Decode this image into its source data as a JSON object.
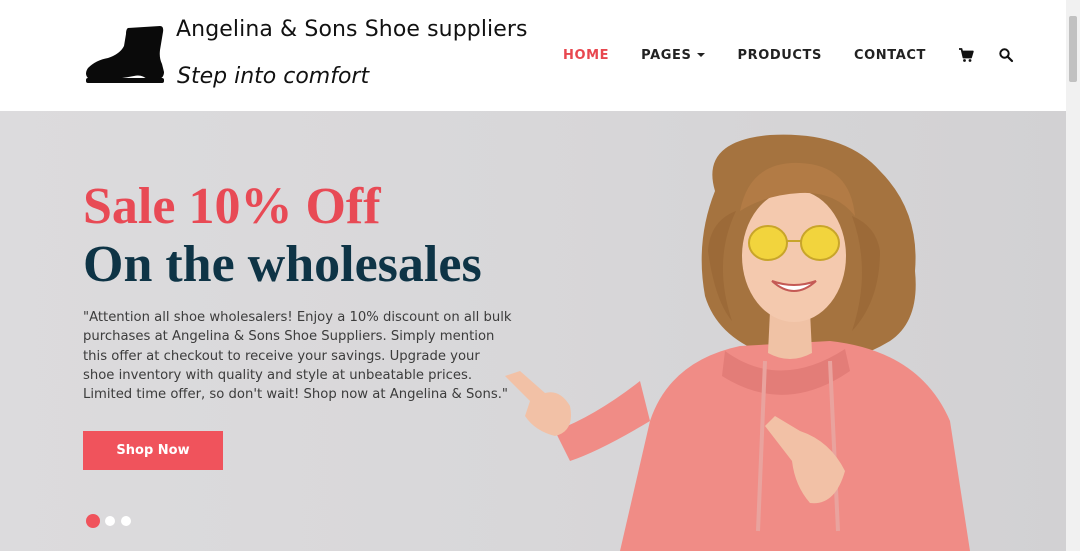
{
  "brand": {
    "name": "Angelina & Sons Shoe suppliers",
    "tagline": "Step into comfort"
  },
  "nav": {
    "items": [
      "HOME",
      "PAGES",
      "PRODUCTS",
      "CONTACT"
    ],
    "active": "HOME",
    "icons": [
      "cart-icon",
      "search-icon"
    ]
  },
  "hero": {
    "headline1": "Sale 10% Off",
    "headline2": "On the wholesales",
    "description": "\"Attention all shoe wholesalers! Enjoy a 10% discount on all bulk purchases at Angelina & Sons Shoe Suppliers. Simply mention this offer at checkout to receive your savings. Upgrade your shoe inventory with quality and style at unbeatable prices. Limited time offer, so don't wait! Shop now at Angelina & Sons.\"",
    "button_label": "Shop Now",
    "slides": 3,
    "active_slide": 1
  },
  "colors": {
    "accent": "#f0535c",
    "headline_red": "#e84a55",
    "headline_navy": "#0e3446",
    "hero_bg": "#d9d8da",
    "hoodie": "#f08c86"
  }
}
